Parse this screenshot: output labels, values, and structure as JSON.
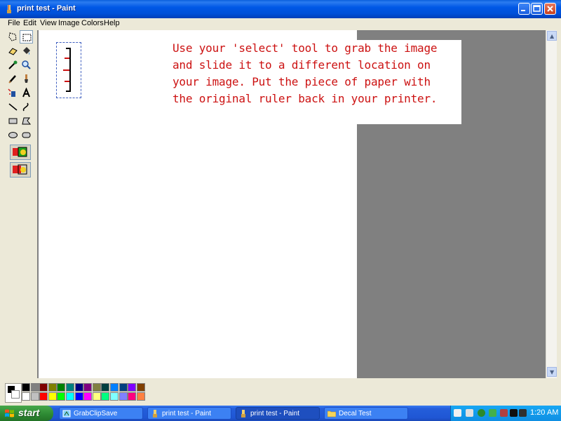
{
  "window": {
    "title": "print test - Paint",
    "controls": {
      "minimize": "minimize-icon",
      "maximize": "maximize-icon",
      "close": "close-icon"
    }
  },
  "menu": [
    "File",
    "Edit",
    "View",
    "Image",
    "Colors",
    "Help"
  ],
  "tools": [
    "free-form-select-icon",
    "rect-select-icon",
    "eraser-icon",
    "fill-icon",
    "pick-color-icon",
    "magnifier-icon",
    "pencil-icon",
    "brush-icon",
    "airbrush-icon",
    "text-icon",
    "line-icon",
    "curve-icon",
    "rectangle-icon",
    "polygon-icon",
    "ellipse-icon",
    "rounded-rect-icon"
  ],
  "selected_tool": "rect-select-icon",
  "canvas": {
    "instruction_lines": [
      "Use your 'select' tool to grab the image",
      "and slide it to a different location on",
      "your image.  Put the piece of paper with",
      "the original ruler back in your printer."
    ],
    "text_color": "#cc1111"
  },
  "palette": {
    "foreground": "#000000",
    "background": "#ffffff",
    "colors": [
      "#000000",
      "#808080",
      "#800000",
      "#808000",
      "#008000",
      "#008080",
      "#000080",
      "#800080",
      "#808040",
      "#004040",
      "#0080ff",
      "#004080",
      "#8000ff",
      "#804000",
      "#ffffff",
      "#c0c0c0",
      "#ff0000",
      "#ffff00",
      "#00ff00",
      "#00ffff",
      "#0000ff",
      "#ff00ff",
      "#ffff80",
      "#00ff80",
      "#80ffff",
      "#8080ff",
      "#ff0080",
      "#ff8040"
    ]
  },
  "taskbar": {
    "start_label": "start",
    "tasks": [
      {
        "label": "GrabClipSave",
        "active": false
      },
      {
        "label": "print test - Paint",
        "active": false
      },
      {
        "label": "print test - Paint",
        "active": true
      },
      {
        "label": "Decal Test",
        "active": false
      }
    ],
    "clock": "1:20 AM"
  }
}
